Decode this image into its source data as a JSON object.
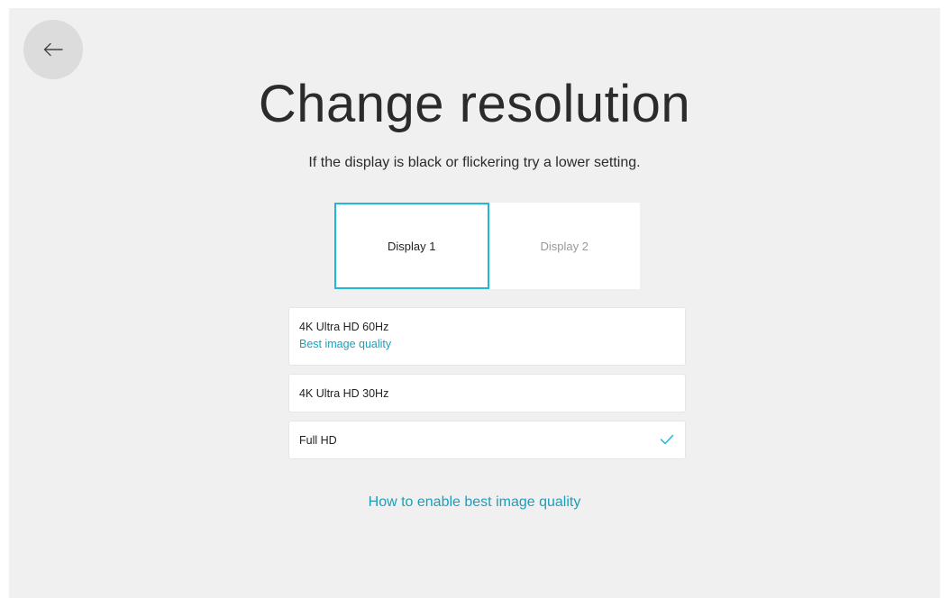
{
  "header": {
    "back_icon": "arrow-left-icon",
    "title": "Change resolution",
    "subtitle": "If the display is black or flickering try a lower setting."
  },
  "tabs": [
    {
      "label": "Display 1",
      "selected": true
    },
    {
      "label": "Display 2",
      "selected": false
    }
  ],
  "options": [
    {
      "label": "4K Ultra HD 60Hz",
      "sublabel": "Best image quality",
      "selected": false
    },
    {
      "label": "4K Ultra HD 30Hz",
      "selected": false
    },
    {
      "label": "Full HD",
      "selected": true,
      "icon": "checkmark-icon"
    }
  ],
  "help_link": "How to enable best image quality",
  "colors": {
    "accent": "#1fb8d6",
    "link": "#1a9fbc",
    "background": "#f0f0f0",
    "card": "#ffffff"
  }
}
